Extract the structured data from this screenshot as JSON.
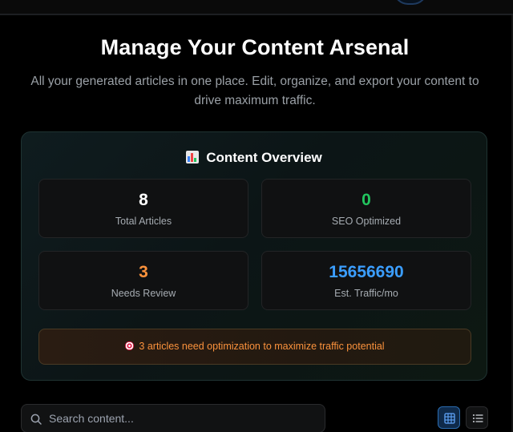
{
  "hero": {
    "title": "Manage Your Content Arsenal",
    "subtitle": "All your generated articles in one place. Edit, organize, and export your content to drive maximum traffic."
  },
  "overview": {
    "icon": "bar-chart-icon",
    "title": "Content Overview",
    "stats": [
      {
        "value": "8",
        "label": "Total Articles",
        "color": "#ffffff"
      },
      {
        "value": "0",
        "label": "SEO Optimized",
        "color": "#22c55e"
      },
      {
        "value": "3",
        "label": "Needs Review",
        "color": "#fb923c"
      },
      {
        "value": "15656690",
        "label": "Est. Traffic/mo",
        "color": "#3b9eff"
      }
    ],
    "alert": {
      "icon": "target-icon",
      "text": "3 articles need optimization to maximize traffic potential"
    }
  },
  "toolbar": {
    "search": {
      "icon": "search-icon",
      "placeholder": "Search content..."
    },
    "view_toggle": {
      "active": "grid",
      "buttons": [
        "grid-view-icon",
        "list-view-icon"
      ]
    }
  },
  "colors": {
    "background": "#000000",
    "accent": "#3b9eff",
    "success": "#22c55e",
    "warning": "#fb923c"
  }
}
